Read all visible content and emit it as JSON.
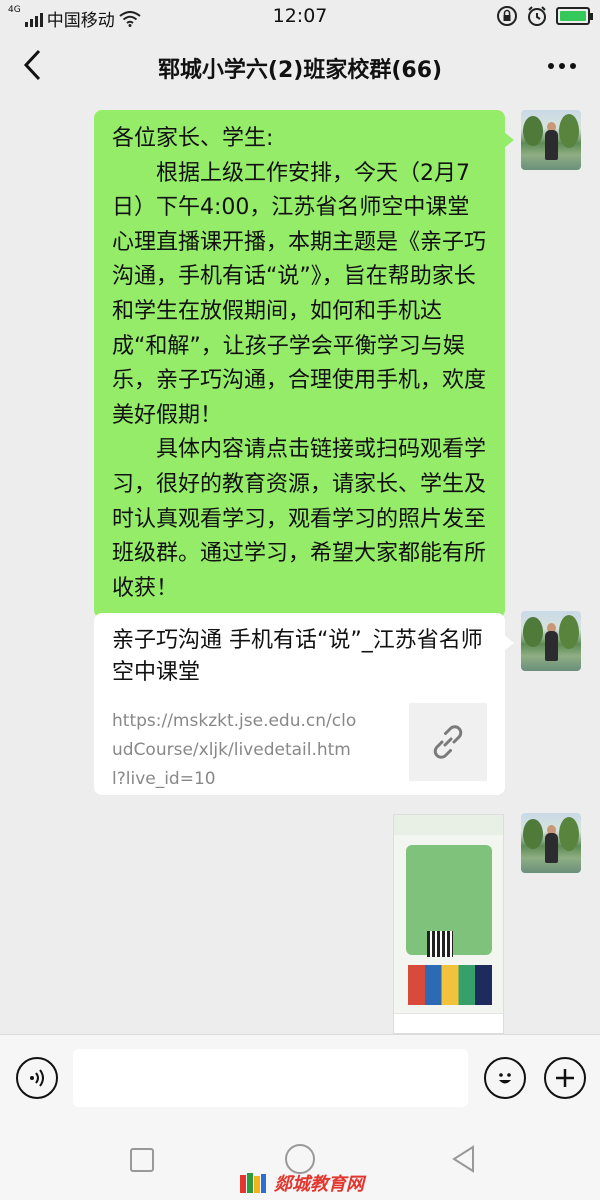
{
  "status_bar": {
    "network": "4G",
    "carrier": "中国移动",
    "time": "12:07"
  },
  "header": {
    "title": "郓城小学六(2)班家校群(66)",
    "back_icon": "chevron-left-icon",
    "more_icon": "more-dots-icon"
  },
  "messages": {
    "announcement": "各位家长、学生:\n　　根据上级工作安排，今天（2月7日）下午4:00，江苏省名师空中课堂心理直播课开播，本期主题是《亲子巧沟通，手机有话“说”》，旨在帮助家长和学生在放假期间，如何和手机达成“和解”，让孩子学会平衡学习与娱乐，亲子巧沟通，合理使用手机，欢度美好假期！\n　　具体内容请点击链接或扫码观看学习，很好的教育资源，请家长、学生及时认真观看学习，观看学习的照片发至班级群。通过学习，希望大家都能有所收获！",
    "link_card": {
      "title": "亲子巧沟通 手机有话“说”_江苏省名师空中课堂",
      "url": "https://mskzkt.jse.edu.cn/cloudCourse/xljk/livedetail.html?live_id=10",
      "thumb_icon": "link-icon"
    }
  },
  "input_bar": {
    "voice_icon": "voice-icon",
    "emoji_icon": "emoji-icon",
    "plus_icon": "plus-icon"
  },
  "watermark": {
    "text": "郯城教育网"
  },
  "colors": {
    "sent_bubble": "#95ec69",
    "background": "#ededed",
    "link_bubble": "#ffffff"
  }
}
